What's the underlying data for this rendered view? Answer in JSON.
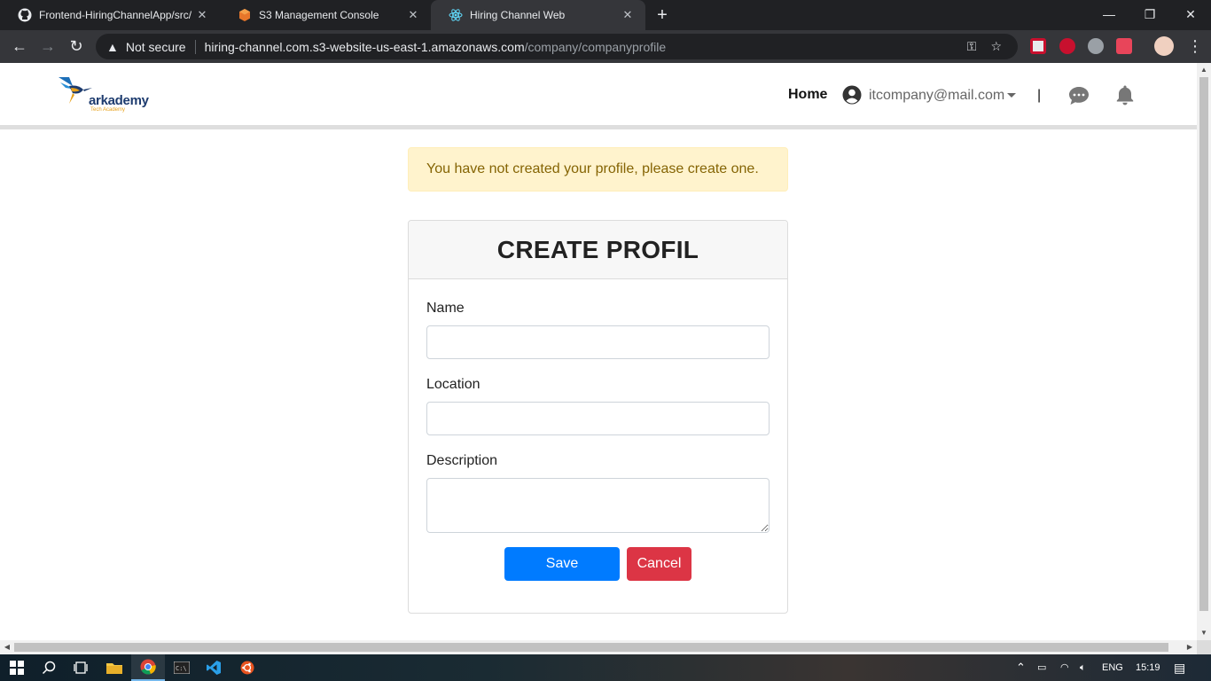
{
  "browser": {
    "tabs": [
      {
        "title": "Frontend-HiringChannelApp/src/",
        "favicon": "github-icon"
      },
      {
        "title": "S3 Management Console",
        "favicon": "aws-icon"
      },
      {
        "title": "Hiring Channel Web",
        "favicon": "react-icon"
      }
    ],
    "security_label": "Not secure",
    "url_host": "hiring-channel.com.s3-website-us-east-1.amazonaws.com",
    "url_path": "/company/companyprofile"
  },
  "navbar": {
    "logo_brand": "arkademy",
    "logo_tagline": "Tech Academy",
    "home_label": "Home",
    "user_email": "itcompany@mail.com",
    "separator": "|"
  },
  "alert": {
    "message": "You have not created your profile, please create one."
  },
  "form": {
    "title": "CREATE PROFIL",
    "name_label": "Name",
    "name_value": "",
    "location_label": "Location",
    "location_value": "",
    "description_label": "Description",
    "description_value": "",
    "save_label": "Save",
    "cancel_label": "Cancel"
  },
  "taskbar": {
    "language": "ENG",
    "time": "15:19"
  },
  "colors": {
    "primary": "#007bff",
    "danger": "#dc3545",
    "warning_bg": "#fff3cd",
    "warning_text": "#856404"
  }
}
